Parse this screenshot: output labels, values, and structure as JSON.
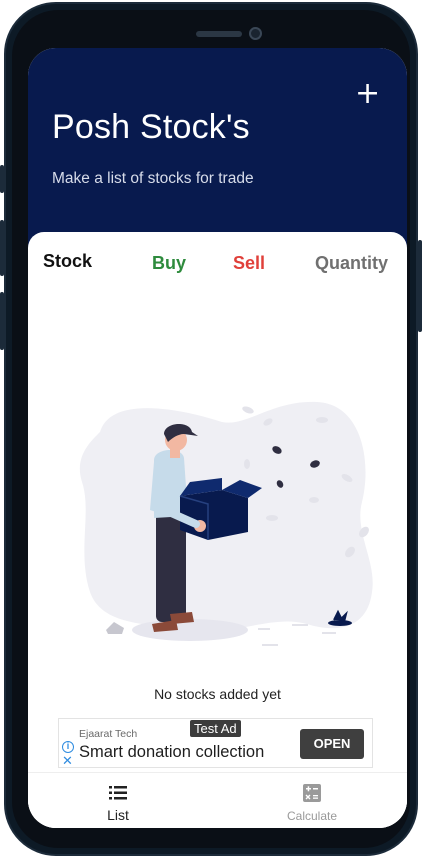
{
  "header": {
    "add_icon": "plus-icon",
    "title": "Posh Stock's",
    "subtitle": "Make a list of stocks for trade"
  },
  "table": {
    "columns": {
      "stock": "Stock",
      "buy": "Buy",
      "sell": "Sell",
      "quantity": "Quantity"
    }
  },
  "empty_state": {
    "message": "No stocks added yet",
    "illustration": "person-holding-box-illustration"
  },
  "ad": {
    "advertiser": "Ejaarat Tech",
    "tag": "Test Ad",
    "headline": "Smart donation collection",
    "cta": "OPEN",
    "info_icon": "info-icon",
    "close_icon": "close-icon"
  },
  "bottom_nav": {
    "items": [
      {
        "label": "List",
        "icon": "list-icon",
        "active": true
      },
      {
        "label": "Calculate",
        "icon": "calculator-icon",
        "active": false
      }
    ]
  },
  "colors": {
    "header_bg": "#081a4e",
    "buy": "#2e8b3d",
    "sell": "#e0403a",
    "quantity": "#707070"
  }
}
